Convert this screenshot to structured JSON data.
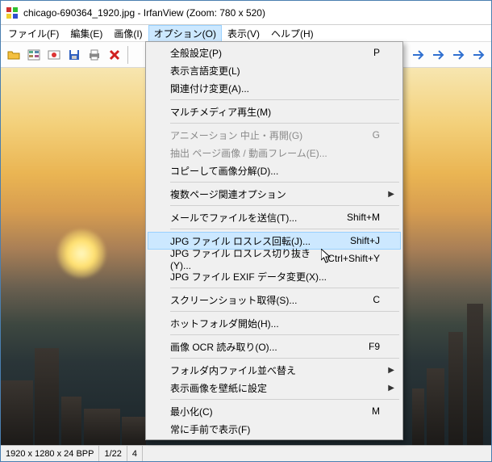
{
  "title": "chicago-690364_1920.jpg - IrfanView (Zoom: 780 x 520)",
  "menubar": [
    "ファイル(F)",
    "編集(E)",
    "画像(I)",
    "オプション(O)",
    "表示(V)",
    "ヘルプ(H)"
  ],
  "menubar_open_index": 3,
  "dropdown": [
    {
      "type": "item",
      "label": "全般設定(P)",
      "shortcut": "P"
    },
    {
      "type": "item",
      "label": "表示言語変更(L)"
    },
    {
      "type": "item",
      "label": "関連付け変更(A)..."
    },
    {
      "type": "sep"
    },
    {
      "type": "item",
      "label": "マルチメディア再生(M)"
    },
    {
      "type": "sep"
    },
    {
      "type": "item",
      "label": "アニメーション 中止・再開(G)",
      "shortcut": "G",
      "disabled": true
    },
    {
      "type": "item",
      "label": "抽出 ページ画像 / 動画フレーム(E)...",
      "disabled": true
    },
    {
      "type": "item",
      "label": "コピーして画像分解(D)..."
    },
    {
      "type": "sep"
    },
    {
      "type": "item",
      "label": "複数ページ関連オプション",
      "submenu": true
    },
    {
      "type": "sep"
    },
    {
      "type": "item",
      "label": "メールでファイルを送信(T)...",
      "shortcut": "Shift+M"
    },
    {
      "type": "sep"
    },
    {
      "type": "item",
      "label": "JPG ファイル ロスレス回転(J)...",
      "shortcut": "Shift+J",
      "hover": true
    },
    {
      "type": "item",
      "label": "JPG ファイル ロスレス切り抜き(Y)...",
      "shortcut": "Ctrl+Shift+Y"
    },
    {
      "type": "item",
      "label": "JPG ファイル EXIF データ変更(X)..."
    },
    {
      "type": "sep"
    },
    {
      "type": "item",
      "label": "スクリーンショット取得(S)...",
      "shortcut": "C"
    },
    {
      "type": "sep"
    },
    {
      "type": "item",
      "label": "ホットフォルダ開始(H)..."
    },
    {
      "type": "sep"
    },
    {
      "type": "item",
      "label": "画像 OCR 読み取り(O)...",
      "shortcut": "F9"
    },
    {
      "type": "sep"
    },
    {
      "type": "item",
      "label": "フォルダ内ファイル並べ替え",
      "submenu": true
    },
    {
      "type": "item",
      "label": "表示画像を壁紙に設定",
      "submenu": true
    },
    {
      "type": "sep"
    },
    {
      "type": "item",
      "label": "最小化(C)",
      "shortcut": "M"
    },
    {
      "type": "item",
      "label": "常に手前で表示(F)"
    }
  ],
  "status": {
    "dim": "1920 x 1280 x 24 BPP",
    "page": "1/22",
    "extra": "4"
  },
  "toolbar_icons": [
    "open",
    "thumbnails",
    "slideshow",
    "save",
    "print",
    "delete",
    "sep",
    "cut",
    "copy",
    "paste",
    "sep",
    "info",
    "sep",
    "rotate-left",
    "rotate-right",
    "sep",
    "zoom-in",
    "zoom-out",
    "sep",
    "prev",
    "next",
    "sep",
    "prev-page",
    "next-page"
  ]
}
